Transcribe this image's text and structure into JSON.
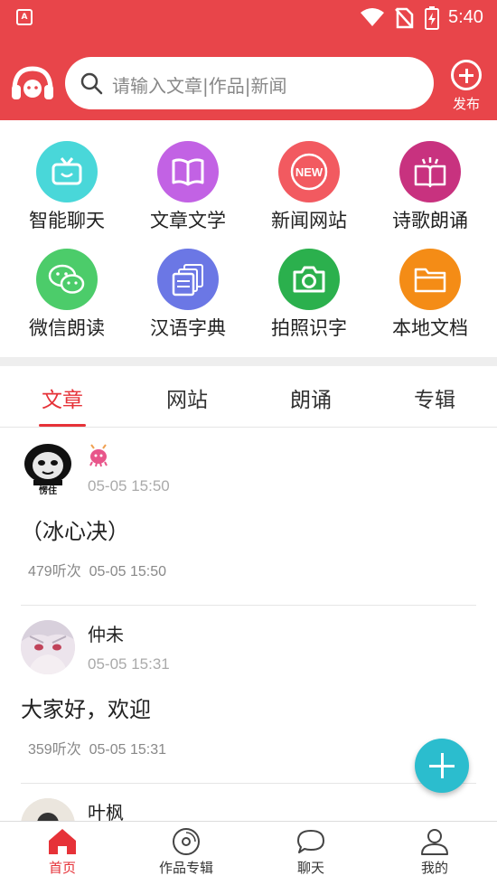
{
  "status_bar": {
    "time": "5:40",
    "app_indicator": "A",
    "icons": [
      "wifi-icon",
      "no-sim-icon",
      "battery-charging-icon"
    ]
  },
  "header": {
    "logo_icon": "headphones-logo-icon",
    "search_placeholder": "请输入文章|作品|新闻",
    "publish_label": "发布",
    "color": "#e8454a"
  },
  "grid": [
    {
      "label": "智能聊天",
      "icon": "tv-icon",
      "color": "#49d7d9"
    },
    {
      "label": "文章文学",
      "icon": "book-icon",
      "color": "#c262e4"
    },
    {
      "label": "新闻网站",
      "icon": "new-badge-icon",
      "color": "#f25a60"
    },
    {
      "label": "诗歌朗诵",
      "icon": "poem-book-icon",
      "color": "#c8327f"
    },
    {
      "label": "微信朗读",
      "icon": "wechat-icon",
      "color": "#4ccc6a"
    },
    {
      "label": "汉语字典",
      "icon": "dictionary-icon",
      "color": "#6b77e5"
    },
    {
      "label": "拍照识字",
      "icon": "camera-icon",
      "color": "#2bb04d"
    },
    {
      "label": "本地文档",
      "icon": "folder-icon",
      "color": "#f48c16"
    }
  ],
  "grid_new_badge_text": "NEW",
  "tabs": [
    "文章",
    "网站",
    "朗诵",
    "专辑"
  ],
  "active_tab": 0,
  "posts": [
    {
      "author": "",
      "author_badge_icon": "pink-bug-icon",
      "avatar_caption": "愣住",
      "time": "05-05 15:50",
      "title": "（冰心决）",
      "listens": "479听次",
      "meta_time": "05-05 15:50"
    },
    {
      "author": "仲未",
      "avatar_icon": "anime-girl-avatar",
      "time": "05-05 15:31",
      "title": "大家好，欢迎",
      "listens": "359听次",
      "meta_time": "05-05 15:31"
    },
    {
      "author": "叶枫",
      "avatar_icon": "user-avatar"
    }
  ],
  "bottom_nav": [
    {
      "label": "首页",
      "icon": "home-icon"
    },
    {
      "label": "作品专辑",
      "icon": "disc-icon"
    },
    {
      "label": "聊天",
      "icon": "chat-bubble-icon"
    },
    {
      "label": "我的",
      "icon": "person-icon"
    }
  ],
  "active_nav": 0,
  "accent_color": "#e63238",
  "fab_color": "#2bbdce"
}
